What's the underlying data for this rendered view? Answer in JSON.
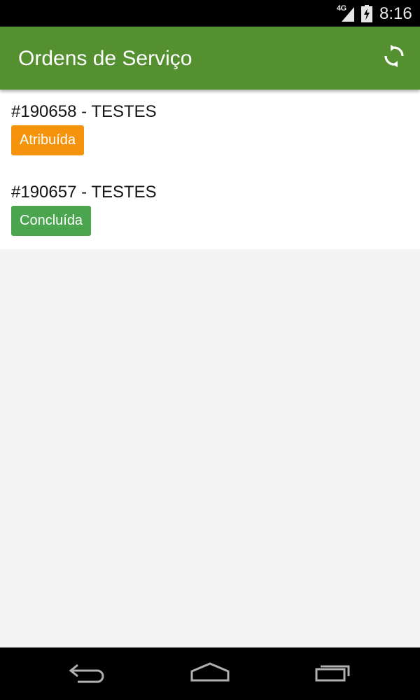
{
  "status_bar": {
    "network": "4G",
    "time": "8:16"
  },
  "app_bar": {
    "title": "Ordens de Serviço",
    "refresh_icon": "refresh-icon"
  },
  "orders": [
    {
      "title": "#190658 - TESTES",
      "status": "Atribuída",
      "status_color": "#f5940c"
    },
    {
      "title": "#190657 - TESTES",
      "status": "Concluída",
      "status_color": "#4ba54f"
    }
  ],
  "nav_bar": {
    "icons": [
      "back-icon",
      "home-icon",
      "recents-icon"
    ]
  },
  "colors": {
    "app_bar": "#559030",
    "status_bar": "#000000",
    "background": "#f4f4f4"
  }
}
